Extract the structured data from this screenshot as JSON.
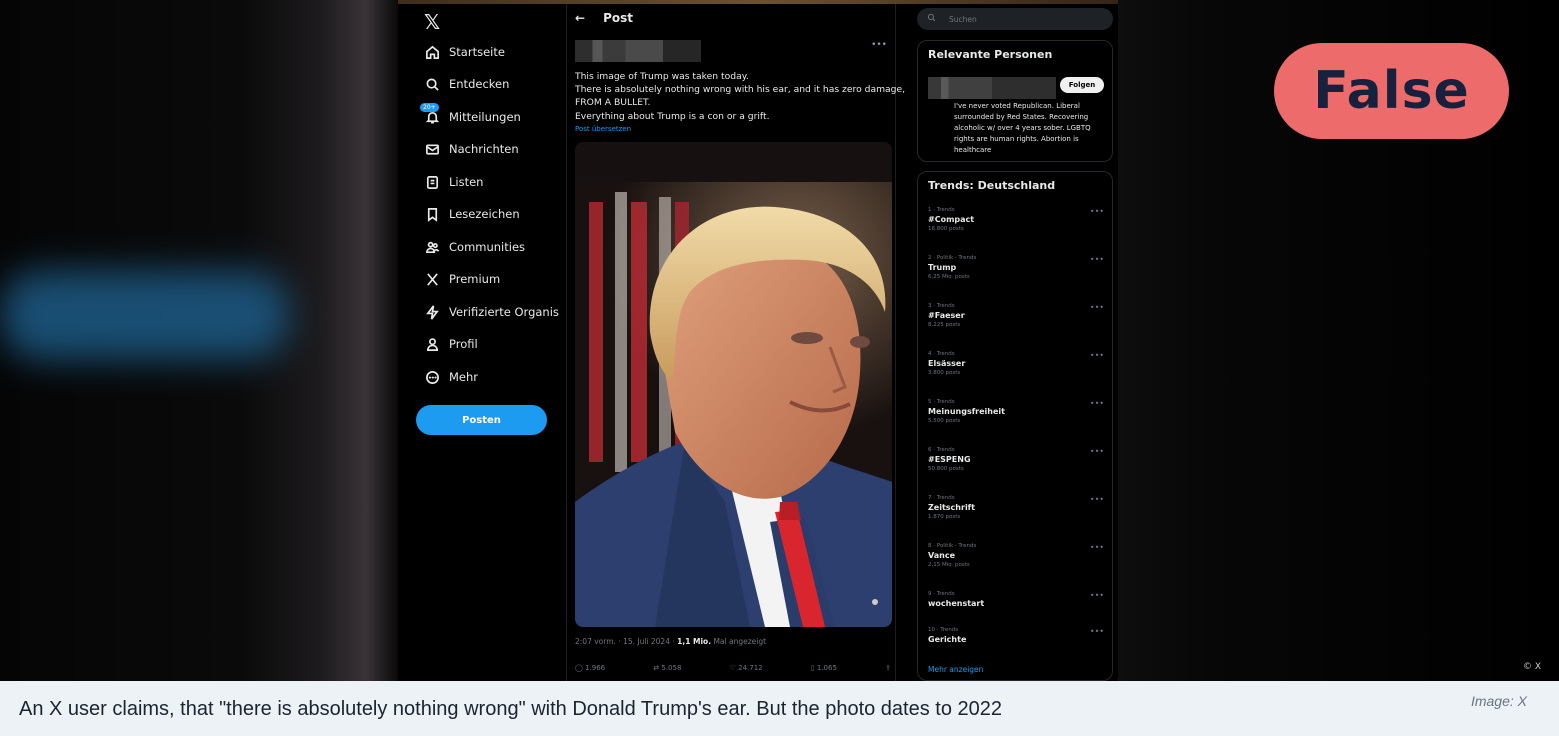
{
  "x_ui": {
    "logo": "𝕏",
    "nav": [
      {
        "label": "Startseite",
        "icon": "home-icon"
      },
      {
        "label": "Entdecken",
        "icon": "search-icon"
      },
      {
        "label": "Mitteilungen",
        "icon": "bell-icon",
        "badge": "20+"
      },
      {
        "label": "Nachrichten",
        "icon": "mail-icon"
      },
      {
        "label": "Listen",
        "icon": "list-icon"
      },
      {
        "label": "Lesezeichen",
        "icon": "bookmark-icon"
      },
      {
        "label": "Communities",
        "icon": "communities-icon"
      },
      {
        "label": "Premium",
        "icon": "x-icon"
      },
      {
        "label": "Verifizierte Organis",
        "icon": "lightning-icon"
      },
      {
        "label": "Profil",
        "icon": "person-icon"
      },
      {
        "label": "Mehr",
        "icon": "more-circle-icon"
      }
    ],
    "post_button": "Posten",
    "post_header": {
      "back": "←",
      "title": "Post"
    },
    "tweet_lines": [
      "This image of Trump was taken today.",
      "There is absolutely nothing wrong with his ear, and it has zero damage,",
      "FROM A BULLET.",
      "Everything about Trump is a con or a grift."
    ],
    "translate_link": "Post übersetzen",
    "meta": {
      "time": "2:07 vorm. · 15. Juli 2024 ·",
      "views": "1,1 Mio.",
      "views_label": "Mal angezeigt"
    },
    "actions": [
      "1.966",
      "5.058",
      "24.712",
      "1.065",
      ""
    ],
    "search_placeholder": "Suchen",
    "relevant": {
      "title": "Relevante Personen",
      "follow": "Folgen",
      "bio": "I've never voted Republican. Liberal surrounded by Red States. Recovering alcoholic w/ over 4 years sober. LGBTQ rights are human rights. Abortion is healthcare"
    },
    "trends": {
      "title": "Trends: Deutschland",
      "items": [
        {
          "cat": "1 · Trends",
          "name": "#Compact",
          "count": "16.800 posts"
        },
        {
          "cat": "2 · Politik · Trends",
          "name": "Trump",
          "count": "6,25 Mio. posts"
        },
        {
          "cat": "3 · Trends",
          "name": "#Faeser",
          "count": "8.225 posts"
        },
        {
          "cat": "4 · Trends",
          "name": "Elsässer",
          "count": "3.800 posts"
        },
        {
          "cat": "5 · Trends",
          "name": "Meinungsfreiheit",
          "count": "5.500 posts"
        },
        {
          "cat": "6 · Trends",
          "name": "#ESPENG",
          "count": "50.800 posts"
        },
        {
          "cat": "7 · Trends",
          "name": "Zeitschrift",
          "count": "1.870 posts"
        },
        {
          "cat": "8 · Politik · Trends",
          "name": "Vance",
          "count": "2,15 Mio. posts"
        },
        {
          "cat": "9 · Trends",
          "name": "wochenstart",
          "count": ""
        },
        {
          "cat": "10 · Trends",
          "name": "Gerichte",
          "count": ""
        }
      ],
      "more": "Mehr anzeigen"
    }
  },
  "verdict": "False",
  "copyright": "© X",
  "caption": "An X user claims, that \"there is absolutely nothing wrong\" with Donald Trump's ear. But the photo dates to 2022",
  "credit": "Image: X",
  "colors": {
    "verdict_bg": "#ee6b6b",
    "verdict_text": "#17213d",
    "x_blue": "#1d9bf0",
    "caption_bg": "#edf2f7"
  }
}
